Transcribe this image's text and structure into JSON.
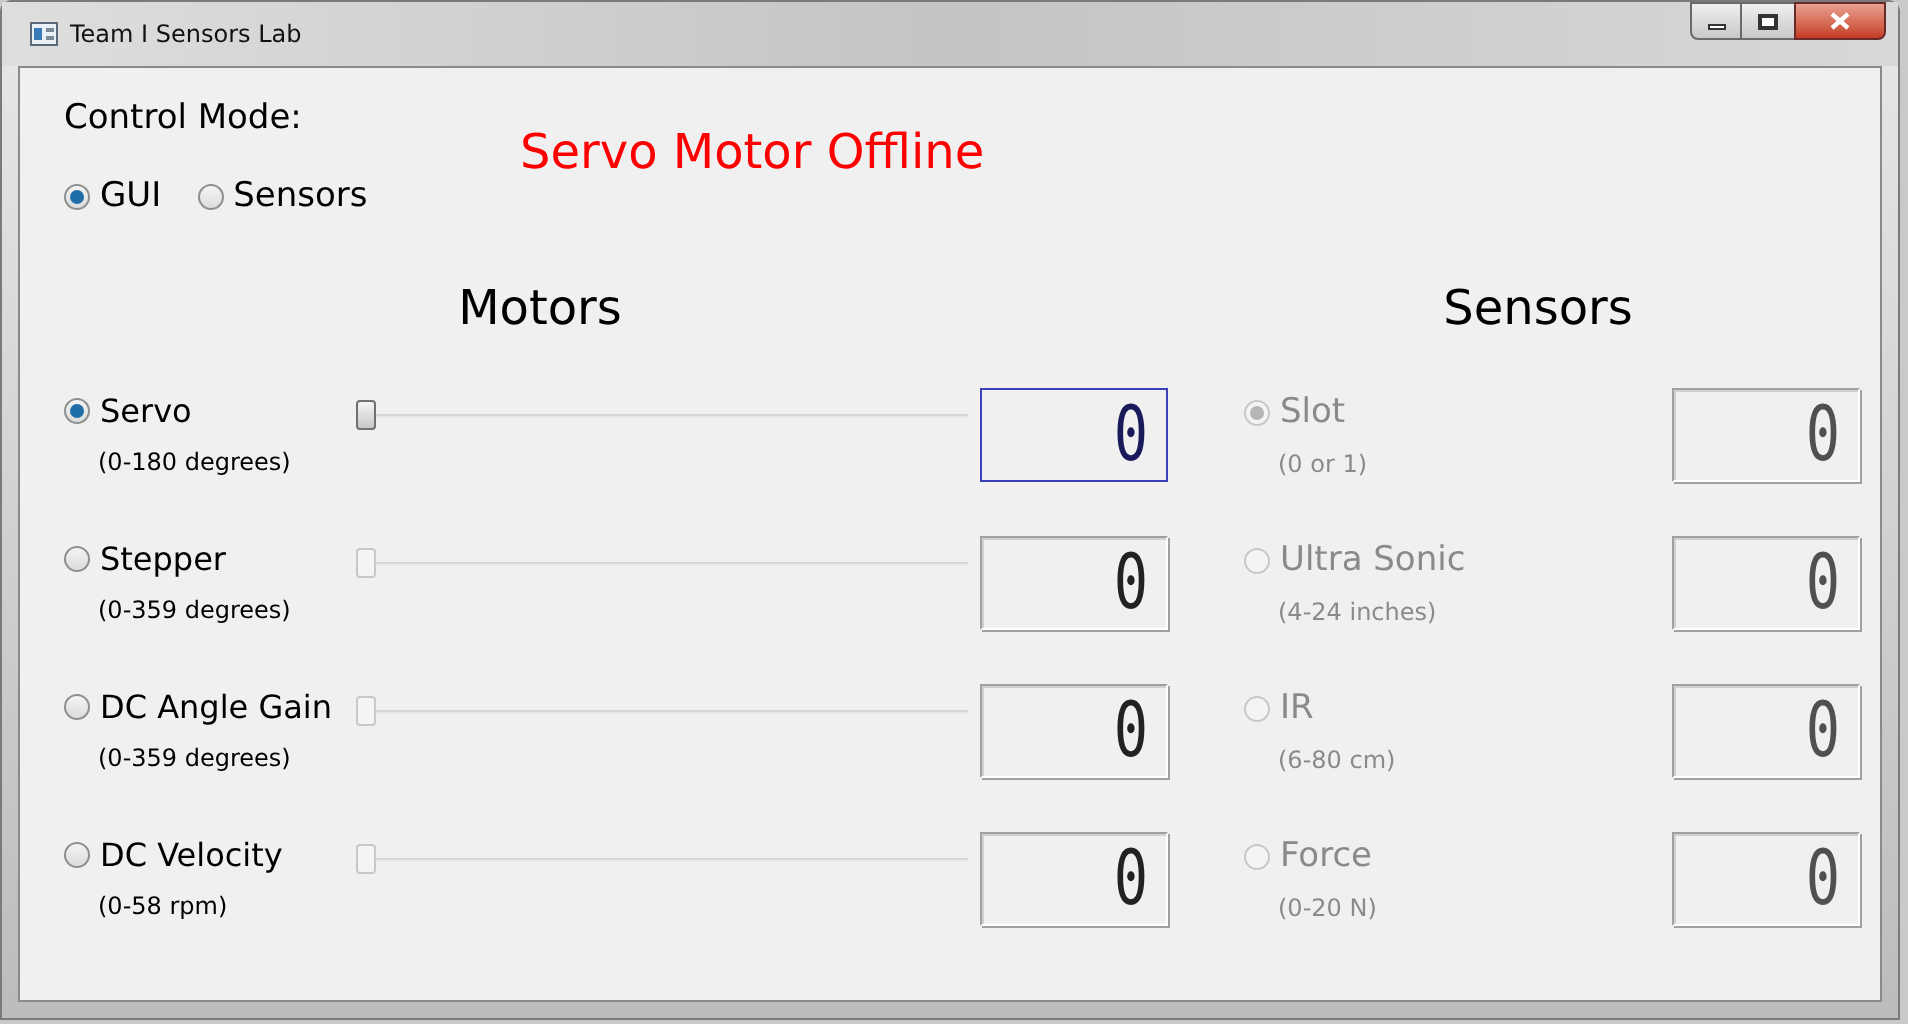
{
  "window": {
    "title": "Team I Sensors Lab"
  },
  "control_mode": {
    "label": "Control Mode:",
    "options": [
      {
        "label": "GUI",
        "selected": true
      },
      {
        "label": "Sensors",
        "selected": false
      }
    ]
  },
  "status_message": "Servo Motor Offline",
  "motors": {
    "heading": "Motors",
    "items": [
      {
        "name": "Servo",
        "range": "(0-180 degrees)",
        "selected": true,
        "focused": true,
        "level": 0,
        "reading": "0"
      },
      {
        "name": "Stepper",
        "range": "(0-359 degrees)",
        "selected": false,
        "focused": false,
        "level": 0,
        "reading": "0"
      },
      {
        "name": "DC Angle Gain",
        "range": "(0-359 degrees)",
        "selected": false,
        "focused": false,
        "level": 0,
        "reading": "0"
      },
      {
        "name": "DC Velocity",
        "range": "(0-58 rpm)",
        "selected": false,
        "focused": false,
        "level": 0,
        "reading": "0"
      }
    ]
  },
  "sensors": {
    "heading": "Sensors",
    "items": [
      {
        "name": "Slot",
        "range": "(0 or 1)",
        "selected": true,
        "disabled": true,
        "reading": "0"
      },
      {
        "name": "Ultra Sonic",
        "range": "(4-24 inches)",
        "selected": false,
        "disabled": true,
        "reading": "0"
      },
      {
        "name": "IR",
        "range": "(6-80 cm)",
        "selected": false,
        "disabled": true,
        "reading": "0"
      },
      {
        "name": "Force",
        "range": "(0-20 N)",
        "selected": false,
        "disabled": true,
        "reading": "0"
      }
    ]
  }
}
